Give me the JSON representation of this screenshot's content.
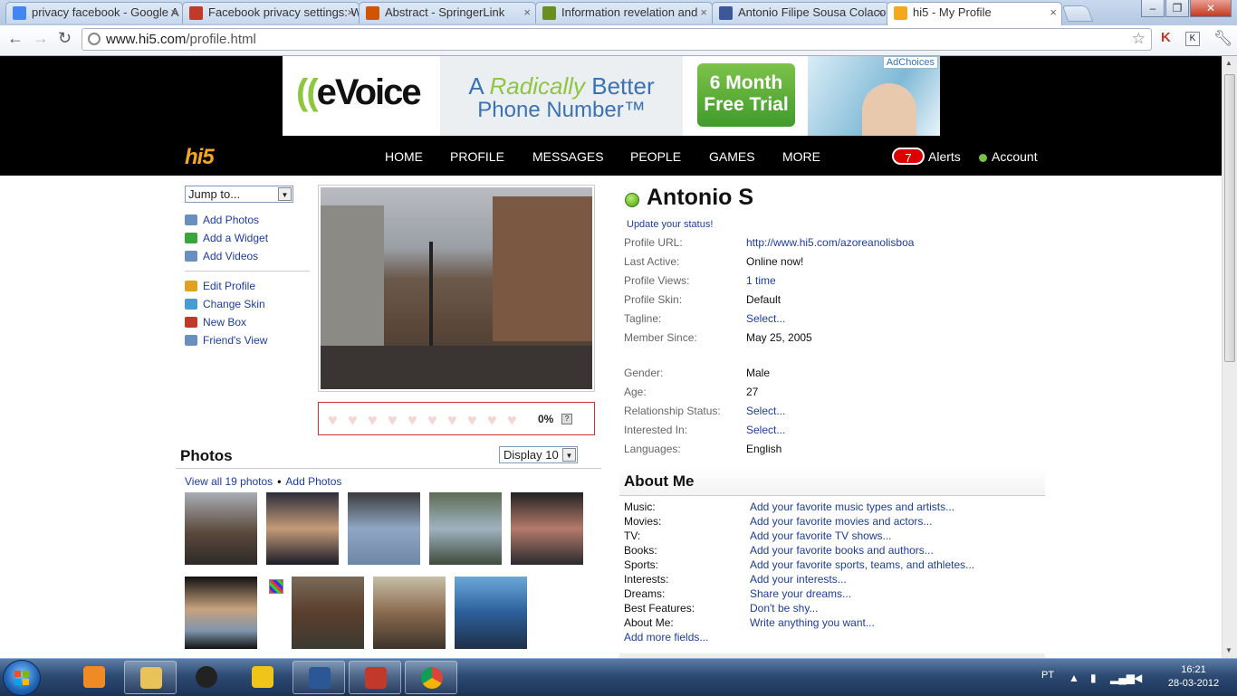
{
  "browser": {
    "tabs": [
      {
        "title": "privacy facebook - Google A",
        "favicon_color": "#4285f4"
      },
      {
        "title": "Facebook privacy settings: W",
        "favicon_color": "#c0392b"
      },
      {
        "title": "Abstract - SpringerLink",
        "favicon_color": "#d35400"
      },
      {
        "title": "Information revelation and",
        "favicon_color": "#6b8e23"
      },
      {
        "title": "Antonio Filipe Sousa Colaco",
        "favicon_color": "#3b5998"
      },
      {
        "title": "hi5 - My Profile",
        "favicon_color": "#f4a81d"
      }
    ],
    "url_domain": "www.hi5.com",
    "url_path": "/profile.html",
    "window_controls": {
      "minimize": "–",
      "maximize": "❐",
      "close": "✕"
    }
  },
  "ad": {
    "brand_prefix": "((",
    "brand": "eVoice",
    "headline_a": "A ",
    "headline_b": "Radically",
    "headline_c": " Better",
    "headline_2": "Phone Number™",
    "cta_line1": "6 Month",
    "cta_line2": "Free Trial",
    "adchoices": "AdChoices"
  },
  "site": {
    "logo": "hi5",
    "nav": [
      "HOME",
      "PROFILE",
      "MESSAGES",
      "PEOPLE",
      "GAMES",
      "MORE"
    ],
    "alerts_count": "7",
    "alerts_label": "Alerts",
    "account_label": "Account"
  },
  "sidebar": {
    "jump_to": "Jump to...",
    "group1": [
      {
        "label": "Add Photos",
        "icon": "photos-icon",
        "color": "#6a8fbf"
      },
      {
        "label": "Add a Widget",
        "icon": "widget-icon",
        "color": "#3aa53a"
      },
      {
        "label": "Add Videos",
        "icon": "videos-icon",
        "color": "#6a8fbf"
      }
    ],
    "group2": [
      {
        "label": "Edit Profile",
        "icon": "pencil-icon",
        "color": "#e0a020"
      },
      {
        "label": "Change Skin",
        "icon": "skin-icon",
        "color": "#4a9ad4"
      },
      {
        "label": "New Box",
        "icon": "box-icon",
        "color": "#c0392b"
      },
      {
        "label": "Friend's View",
        "icon": "friend-view-icon",
        "color": "#6a8fbf"
      }
    ]
  },
  "rating": {
    "hearts": 10,
    "percent": "0%",
    "help": "?"
  },
  "photos": {
    "title": "Photos",
    "display": "Display 10",
    "view_all": "View all 19 photos",
    "add": "Add Photos"
  },
  "profile": {
    "name": "Antonio S",
    "update_status": "Update your status!",
    "fields1": [
      {
        "label": "Profile URL:",
        "value": "http://www.hi5.com/azoreanolisboa",
        "link": true
      },
      {
        "label": "Last Active:",
        "value": "Online now!",
        "link": false
      },
      {
        "label": "Profile Views:",
        "value": "1 time",
        "link": true
      },
      {
        "label": "Profile Skin:",
        "value": "Default",
        "link": false
      },
      {
        "label": "Tagline:",
        "value": "Select...",
        "link": true
      },
      {
        "label": "Member Since:",
        "value": "May 25, 2005",
        "link": false
      }
    ],
    "fields2": [
      {
        "label": "Gender:",
        "value": "Male",
        "link": false
      },
      {
        "label": "Age:",
        "value": "27",
        "link": false
      },
      {
        "label": "Relationship Status:",
        "value": "Select...",
        "link": true
      },
      {
        "label": "Interested In:",
        "value": "Select...",
        "link": true
      },
      {
        "label": "Languages:",
        "value": "English",
        "link": false
      }
    ]
  },
  "about": {
    "title": "About Me",
    "fields": [
      {
        "label": "Music:",
        "value": "Add your favorite music types and artists..."
      },
      {
        "label": "Movies:",
        "value": "Add your favorite movies and actors..."
      },
      {
        "label": "TV:",
        "value": "Add your favorite TV shows..."
      },
      {
        "label": "Books:",
        "value": "Add your favorite books and authors..."
      },
      {
        "label": "Sports:",
        "value": "Add your favorite sports, teams, and athletes..."
      },
      {
        "label": "Interests:",
        "value": "Add your interests..."
      },
      {
        "label": "Dreams:",
        "value": "Share your dreams..."
      },
      {
        "label": "Best Features:",
        "value": "Don't be shy..."
      },
      {
        "label": "About Me:",
        "value": "Write anything you want..."
      }
    ],
    "add_more": "Add more fields..."
  },
  "taskbar": {
    "apps": [
      {
        "name": "media-player-icon",
        "color": "#f08a24"
      },
      {
        "name": "explorer-icon",
        "color": "#e8c35a"
      },
      {
        "name": "hp-icon",
        "color": "#222"
      },
      {
        "name": "tools-icon",
        "color": "#f0c419"
      },
      {
        "name": "word-icon",
        "color": "#2b5797"
      },
      {
        "name": "pdf-icon",
        "color": "#c0392b"
      },
      {
        "name": "chrome-icon",
        "color": "#4caf50"
      }
    ],
    "lang": "PT",
    "time": "16:21",
    "date": "28-03-2012"
  }
}
